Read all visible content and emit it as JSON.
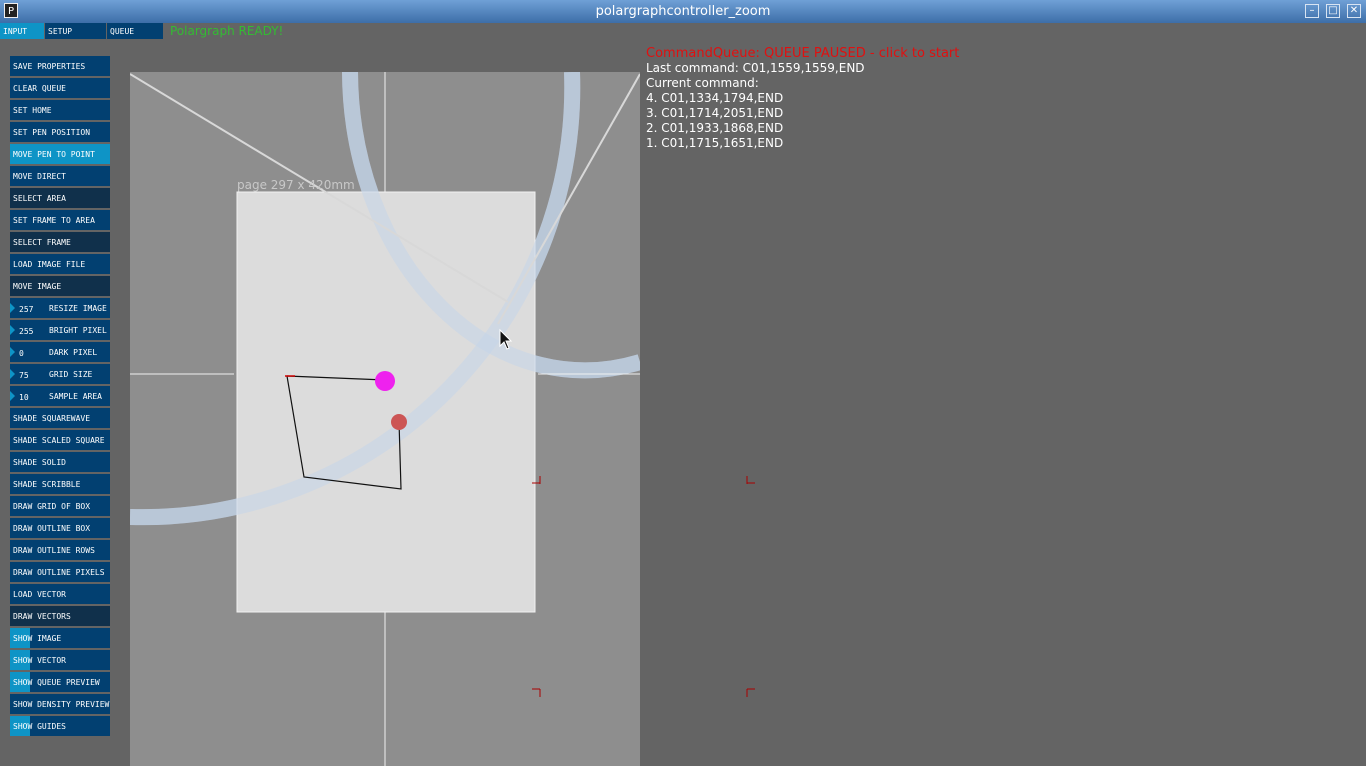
{
  "window": {
    "title": "polargraphcontroller_zoom",
    "app_icon": "P"
  },
  "tabs": [
    {
      "label": "INPUT",
      "color": "#0e94c6"
    },
    {
      "label": "SETUP",
      "color": "#024071"
    },
    {
      "label": "QUEUE",
      "color": "#024071"
    }
  ],
  "status": {
    "text": "Polargraph READY!",
    "color": "#33bb33"
  },
  "buttons": [
    "SAVE PROPERTIES",
    "CLEAR QUEUE",
    "SET HOME",
    "SET PEN POSITION",
    "MOVE PEN TO POINT",
    "MOVE DIRECT",
    "SELECT AREA",
    "SET FRAME TO AREA",
    "SELECT FRAME",
    "LOAD IMAGE FILE",
    "MOVE IMAGE"
  ],
  "number_fields": [
    {
      "value": "257",
      "label": "RESIZE IMAGE"
    },
    {
      "value": "255",
      "label": "BRIGHT PIXEL"
    },
    {
      "value": "0",
      "label": "DARK PIXEL"
    },
    {
      "value": "75",
      "label": "GRID SIZE"
    },
    {
      "value": "10",
      "label": "SAMPLE AREA"
    }
  ],
  "actions": [
    "SHADE SQUAREWAVE",
    "SHADE SCALED SQUARE",
    "SHADE SOLID",
    "SHADE SCRIBBLE",
    "DRAW GRID OF BOX",
    "DRAW OUTLINE BOX",
    "DRAW OUTLINE ROWS",
    "DRAW OUTLINE PIXELS",
    "LOAD VECTOR",
    "DRAW VECTORS"
  ],
  "toggles": [
    {
      "label": "SHOW IMAGE",
      "on": true
    },
    {
      "label": "SHOW VECTOR",
      "on": true
    },
    {
      "label": "SHOW QUEUE PREVIEW",
      "on": true
    },
    {
      "label": "SHOW DENSITY PREVIEW",
      "on": false
    },
    {
      "label": "SHOW GUIDES",
      "on": true
    }
  ],
  "page_label": "page 297 x 420mm",
  "queue": {
    "status": "CommandQueue: QUEUE PAUSED - click to start",
    "last_command": "Last command: C01,1559,1559,END",
    "current_label": "Current command:",
    "items": [
      "4. C01,1334,1794,END",
      "3. C01,1714,2051,END",
      "2. C01,1933,1868,END",
      "1. C01,1715,1651,END"
    ]
  },
  "colors": {
    "pen_marker": "#ee22ee",
    "target_marker": "#cc5555",
    "button_bg": "#024071",
    "button_active": "#0e94c6",
    "queue_paused": "#e01010"
  }
}
